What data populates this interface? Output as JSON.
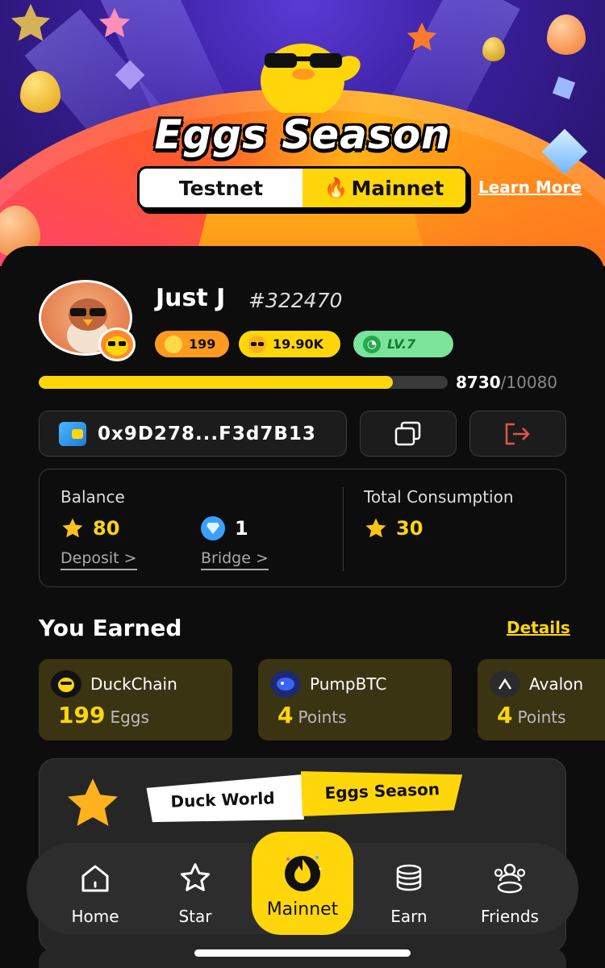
{
  "hero": {
    "title": "Eggs Season",
    "toggle": {
      "testnet": "Testnet",
      "mainnet": "Mainnet",
      "active": "mainnet"
    },
    "learn_more": "Learn More"
  },
  "profile": {
    "username": "Just J",
    "user_id": "#322470",
    "eggs": "199",
    "coins": "19.90K",
    "level": "LV.7",
    "xp_current": "8730",
    "xp_max": "/10080",
    "xp_fraction": 0.866
  },
  "wallet": {
    "address": "0x9D278...F3d7B13"
  },
  "balance": {
    "label": "Balance",
    "stars": "80",
    "gems": "1",
    "deposit": "Deposit >",
    "bridge": "Bridge >",
    "total_label": "Total Consumption",
    "total_value": "30"
  },
  "earned": {
    "title": "You Earned",
    "details": "Details",
    "items": [
      {
        "name": "DuckChain",
        "amount": "199",
        "unit": "Eggs"
      },
      {
        "name": "PumpBTC",
        "amount": "4",
        "unit": "Points"
      },
      {
        "name": "Avalon",
        "amount": "4",
        "unit": "Points"
      }
    ]
  },
  "promo": {
    "left_tab": "Duck World",
    "right_tab": "Eggs Season"
  },
  "nav": {
    "items": [
      {
        "label": "Home",
        "icon": "home-icon"
      },
      {
        "label": "Star",
        "icon": "star-outline-icon"
      },
      {
        "label": "Mainnet",
        "icon": "flame-icon"
      },
      {
        "label": "Earn",
        "icon": "coin-stack-icon"
      },
      {
        "label": "Friends",
        "icon": "friends-icon"
      }
    ],
    "active": "Mainnet"
  },
  "colors": {
    "accent": "#ffd60a",
    "card": "#0d0d0d",
    "panel": "#3a3412"
  }
}
